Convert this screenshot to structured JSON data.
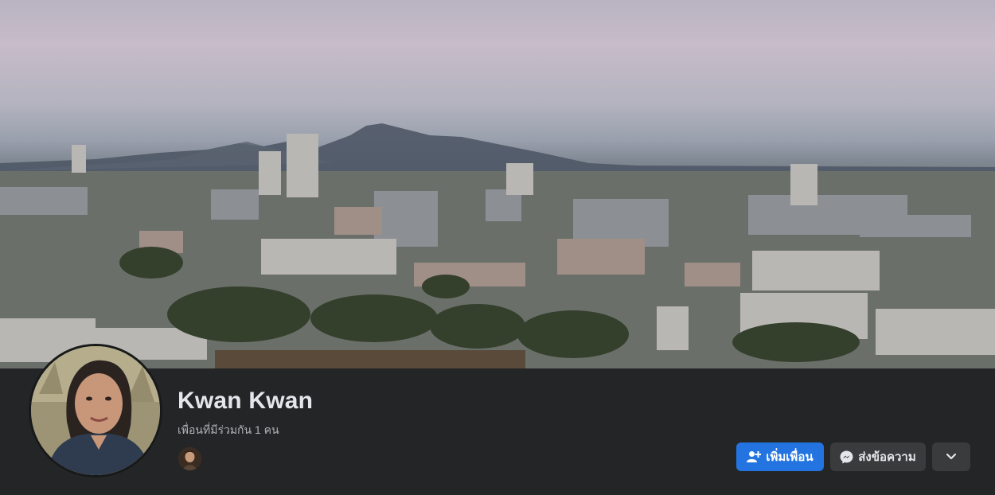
{
  "profile": {
    "name": "Kwan Kwan",
    "mutual_friends": "เพื่อนที่มีร่วมกัน 1 คน"
  },
  "actions": {
    "add_friend_label": "เพิ่มเพื่อน",
    "message_label": "ส่งข้อความ",
    "more_icon": "chevron-down-icon"
  },
  "icons": {
    "add_friend": "person-add-icon",
    "message": "messenger-icon"
  },
  "colors": {
    "background": "#242526",
    "primary": "#2374e1",
    "secondary_button": "#3a3b3c",
    "text": "#e4e6eb",
    "muted_text": "#b0b3b8"
  }
}
